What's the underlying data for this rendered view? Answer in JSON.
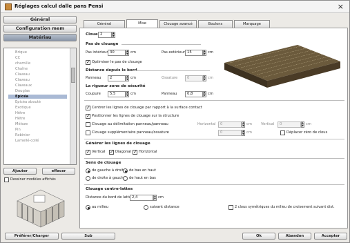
{
  "window": {
    "title": "Réglages calcul dalle pans Pensi",
    "close_glyph": "×"
  },
  "sidebar": {
    "sections": [
      "Général",
      "Configuration mem",
      "Matériau"
    ],
    "materials": [
      "Brique",
      "CC",
      "charnille",
      "Chaîne",
      "Claveau",
      "Claveau",
      "Claveaux",
      "Douglas",
      "Epicéa",
      "Epicéa abouté",
      "Exotique",
      "Hêtre",
      "Hêtre",
      "Méleze",
      "Pin",
      "Robinier",
      "Lamellé-collé"
    ],
    "selected_index": 8,
    "add_label": "Ajouter",
    "delete_label": "effacer",
    "show_all_label": "Dessiner modèles affichés"
  },
  "tabs": [
    "Général",
    "Mise",
    "Clouage avancé",
    "Boulons",
    "Marquage"
  ],
  "active_tab": 1,
  "content": {
    "clouer_label": "Clouer",
    "clouer_value": "2",
    "pas_title": "Pas de clouage",
    "pas_interieur_label": "Pas intérieur",
    "pas_interieur_value": "30",
    "pas_exterieur_label": "Pas extérieur",
    "pas_exterieur_value": "15",
    "unit": "cm",
    "optimiser_label": "Optimiser le pas de clouage",
    "distance_title": "Distance depuis le bord",
    "panneau_label": "Panneau",
    "panneau_value": "2",
    "ossature_label": "Ossature",
    "ossature_value": "0",
    "securite_title": "La rigueur zone de sécurité",
    "coupure_label": "Coupure",
    "coupure_value": "5,5",
    "panneau2_label": "Panneau",
    "panneau2_value": "0,8",
    "option1": "Centrer les lignes de clouage par rapport à la surface contact",
    "option2": "Positionner les lignes de clouage sur la structure",
    "option3": "Clouage au délimitation panneau/panneau",
    "option4": "Clouage supplémentaire panneau/ossature",
    "horizontal_label": "Horizontal",
    "vertical_label": "Vertical",
    "h_value": "0",
    "v_value": "0",
    "v2_value": "0",
    "deplacer_label": "Déplacer zéro de clous",
    "generer_title": "Générer les lignes de clouage",
    "gen_vertical": "Vertical",
    "gen_biais": "Diagonal",
    "gen_horizontal": "Horizontal",
    "sens_title": "Sens de clouage",
    "sens_opts": [
      "de gauche à droite",
      "de bas en haut",
      "de droite à gauche",
      "de haut en bas"
    ],
    "contre_title": "Clouage contre-lattes",
    "distance_bord_label": "Distance du bord de latte",
    "distance_bord_value": "2,4",
    "au_milieu": "au milieu",
    "suivant_distance": "suivant distance",
    "symetrie_label": "2 clous symétriques du milieu de croisement suivant dist."
  },
  "footer": {
    "left1": "Préférer/Charger",
    "left2": "Sub",
    "ok": "Ok",
    "cancel": "Abandon",
    "accept": "Accepter"
  }
}
